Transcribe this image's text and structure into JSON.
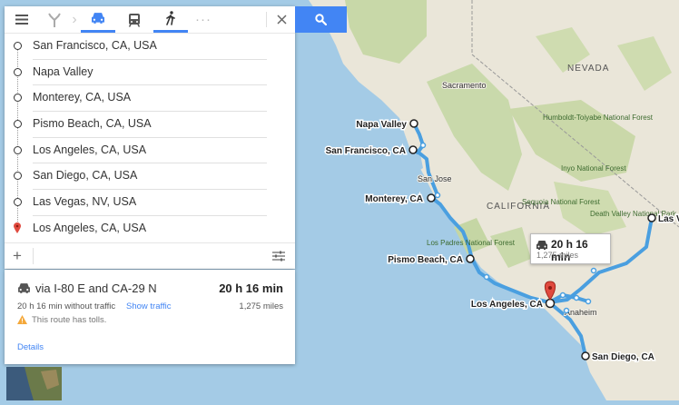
{
  "toolbar": {
    "menu_icon": "menu-icon",
    "modes": [
      {
        "name": "best-route-icon"
      },
      {
        "name": "car-icon"
      },
      {
        "name": "transit-icon"
      },
      {
        "name": "walk-icon"
      },
      {
        "name": "more-icon"
      }
    ],
    "close_icon": "close-icon",
    "search_icon": "search-icon",
    "accent": "#4285f4"
  },
  "stops": [
    {
      "label": "San Francisco, CA, USA"
    },
    {
      "label": "Napa Valley"
    },
    {
      "label": "Monterey, CA, USA"
    },
    {
      "label": "Pismo Beach, CA, USA"
    },
    {
      "label": "Los Angeles, CA, USA"
    },
    {
      "label": "San Diego, CA, USA"
    },
    {
      "label": "Las Vegas, NV, USA"
    },
    {
      "label": "Los Angeles, CA, USA"
    }
  ],
  "route": {
    "via": "via I-80 E and CA-29 N",
    "duration": "20 h 16 min",
    "traffic_note": "20 h 16 min without traffic",
    "show_traffic": "Show traffic",
    "distance": "1,275 miles",
    "warning": "This route has tolls.",
    "details": "Details",
    "warning_color": "#f4a83a",
    "link_color": "#4285f4"
  },
  "map": {
    "state_label": "CALIFORNIA",
    "nevada_label": "NEVADA",
    "cities": [
      "Sacramento",
      "San Jose",
      "Anaheim"
    ],
    "parks": [
      "Humboldt-Toiyabe National Forest",
      "Inyo National Forest",
      "Sequoia National Forest",
      "Death Valley National Park",
      "Los Padres National Forest"
    ],
    "markers": [
      {
        "label": "Napa Valley"
      },
      {
        "label": "San Francisco, CA"
      },
      {
        "label": "Monterey, CA"
      },
      {
        "label": "Pismo Beach, CA"
      },
      {
        "label": "Los Angeles, CA"
      },
      {
        "label": "San Diego, CA"
      },
      {
        "label": "Las V"
      }
    ],
    "callout": {
      "duration": "20 h 16 min",
      "distance": "1,275 miles"
    },
    "route_color": "#4a9fe0"
  }
}
